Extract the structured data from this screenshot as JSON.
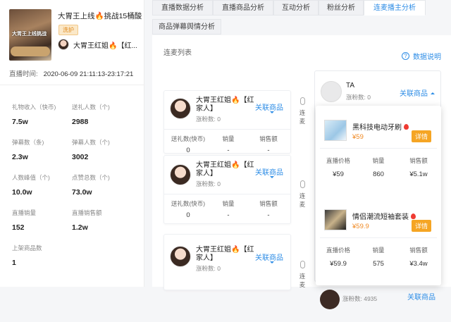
{
  "stream": {
    "thumb_text": "大胃王上线挑战",
    "title": "大胃王上线🔥挑战15桶酸",
    "badge": "洗护",
    "anchor_name": "大胃王红姐🔥【红...",
    "time_label": "直播时间:",
    "time_value": "2020-06-09 21:11:13-23:17:21"
  },
  "stats": [
    {
      "label": "礼物收入（快币)",
      "value": "7.5w"
    },
    {
      "label": "送礼人数（个)",
      "value": "2988"
    },
    {
      "label": "弹幕数（条)",
      "value": "2.3w"
    },
    {
      "label": "弹幕人数（个)",
      "value": "3002"
    },
    {
      "label": "人数峰值（个)",
      "value": "10.0w"
    },
    {
      "label": "点赞总数（个)",
      "value": "73.0w"
    },
    {
      "label": "直播销量",
      "value": "152"
    },
    {
      "label": "直播销售额",
      "value": "1.2w"
    },
    {
      "label": "上架商品数",
      "value": "1"
    }
  ],
  "tabs": [
    "直播数据分析",
    "直播商品分析",
    "互动分析",
    "粉丝分析",
    "连麦播主分析",
    "商品弹幕舆情分析"
  ],
  "main": {
    "list_title": "连麦列表",
    "help": "数据说明",
    "link_label": "连麦"
  },
  "cards": [
    {
      "name": "大胃王红姐🔥【红家人】",
      "fans_label": "涨粉数:",
      "fans": "0",
      "related": "关联商品",
      "m1_label": "送礼数(快币)",
      "m1": "0",
      "m2_label": "销量",
      "m2": "-",
      "m3_label": "销售额",
      "m3": "-"
    },
    {
      "name": "大胃王红姐🔥【红家人】",
      "fans_label": "涨粉数:",
      "fans": "0",
      "related": "关联商品",
      "m1_label": "送礼数(快币)",
      "m1": "0",
      "m2_label": "销量",
      "m2": "-",
      "m3_label": "销售额",
      "m3": "-"
    },
    {
      "name": "大胃王红姐🔥【红家人】",
      "fans_label": "涨粉数:",
      "fans": "0",
      "related": "关联商品"
    }
  ],
  "ta": {
    "name": "TA",
    "fans_label": "涨粉数:",
    "fans": "0",
    "related": "关联商品",
    "bottom_fans": "涨粉数: 4935",
    "bottom_related": "关联商品"
  },
  "products": [
    {
      "name": "黑科技电动牙刷",
      "price": "¥59",
      "detail": "详情",
      "l1": "直播价格",
      "v1": "¥59",
      "l2": "销量",
      "v2": "860",
      "l3": "销售额",
      "v3": "¥5.1w"
    },
    {
      "name": "情侣潮流短袖套装",
      "price": "¥59.9",
      "detail": "详情",
      "l1": "直播价格",
      "v1": "¥59.9",
      "l2": "销量",
      "v2": "575",
      "l3": "销售额",
      "v3": "¥3.4w"
    }
  ]
}
